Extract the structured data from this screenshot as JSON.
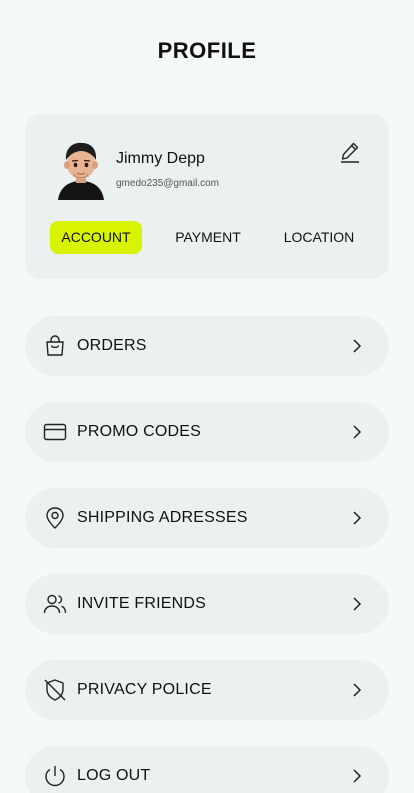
{
  "header": {
    "title": "PROFILE"
  },
  "profile": {
    "name": "Jimmy Depp",
    "email": "gmedo235@gmail.com"
  },
  "tabs": [
    {
      "label": "ACCOUNT",
      "active": true
    },
    {
      "label": "PAYMENT",
      "active": false
    },
    {
      "label": "LOCATION",
      "active": false
    }
  ],
  "menu": [
    {
      "label": "ORDERS",
      "icon": "shopping-bag-icon"
    },
    {
      "label": "PROMO CODES",
      "icon": "credit-card-icon"
    },
    {
      "label": "SHIPPING ADRESSES",
      "icon": "map-pin-icon"
    },
    {
      "label": "INVITE FRIENDS",
      "icon": "users-icon"
    },
    {
      "label": "PRIVACY POLICE",
      "icon": "shield-off-icon"
    },
    {
      "label": "LOG OUT",
      "icon": "power-icon"
    }
  ],
  "colors": {
    "accent": "#d8f400",
    "card": "#ebf0f1",
    "background": "#f6f9f9"
  }
}
